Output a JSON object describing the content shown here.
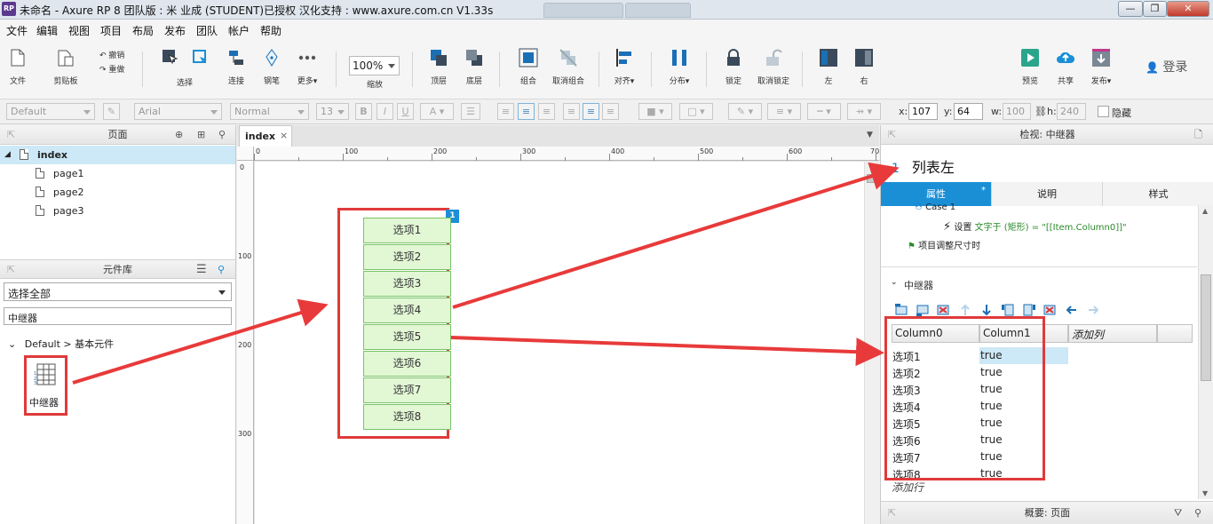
{
  "window": {
    "title": "未命名 - Axure RP 8 团队版 : 米 业成 (STUDENT)已授权 汉化支持 : www.axure.com.cn V1.33s",
    "logo": "RP"
  },
  "menu": [
    "文件",
    "编辑",
    "视图",
    "项目",
    "布局",
    "发布",
    "团队",
    "帐户",
    "帮助"
  ],
  "toolbar": {
    "file": "文件",
    "clipboard": "剪贴板",
    "undo": "撤销",
    "redo": "重做",
    "select": "选择",
    "connect": "连接",
    "pen": "钢笔",
    "more": "更多▾",
    "zoom_value": "100%",
    "zoom_label": "缩放",
    "top": "顶层",
    "bottom": "底层",
    "group": "组合",
    "ungroup": "取消组合",
    "align": "对齐▾",
    "distribute": "分布▾",
    "lock": "锁定",
    "unlock": "取消锁定",
    "left": "左",
    "right": "右",
    "preview": "预览",
    "share": "共享",
    "publish": "发布▾",
    "login": "登录"
  },
  "formatbar": {
    "style": "Default",
    "font": "Arial",
    "weight": "Normal",
    "size": "13",
    "x_label": "x:",
    "x": "107",
    "y_label": "y:",
    "y": "64",
    "w_label": "w:",
    "w": "100",
    "h_label": "h:",
    "h": "240",
    "hide": "隐藏"
  },
  "pages_panel": {
    "title": "页面",
    "pages": [
      "index",
      "page1",
      "page2",
      "page3"
    ]
  },
  "library_panel": {
    "title": "元件库",
    "filter": "选择全部",
    "search": "中继器",
    "group": "Default > 基本元件",
    "widget": "中继器"
  },
  "canvas": {
    "tab": "index",
    "tab_close": "×",
    "ruler_top": [
      "0",
      "100",
      "200",
      "300",
      "400",
      "500",
      "600",
      "70"
    ],
    "ruler_left": [
      "0",
      "100",
      "200",
      "300"
    ],
    "badge": "1",
    "items": [
      "选项1",
      "选项2",
      "选项3",
      "选项4",
      "选项5",
      "选项6",
      "选项7",
      "选项8"
    ]
  },
  "inspector": {
    "title": "检视: 中继器",
    "index": "1",
    "name": "列表左",
    "tabs": [
      "属性",
      "说明",
      "样式"
    ],
    "tab_marker": "*",
    "case": "Case 1",
    "action_prefix": "设置",
    "action_green": "文字于 (矩形)",
    "action_value": "= \"[[Item.Column0]]\"",
    "event": "项目调整尺寸时",
    "section": "中继器",
    "columns": [
      "Column0",
      "Column1",
      "添加列"
    ],
    "rows": [
      [
        "选项1",
        "true"
      ],
      [
        "选项2",
        "true"
      ],
      [
        "选项3",
        "true"
      ],
      [
        "选项4",
        "true"
      ],
      [
        "选项5",
        "true"
      ],
      [
        "选项6",
        "true"
      ],
      [
        "选项7",
        "true"
      ],
      [
        "选项8",
        "true"
      ]
    ],
    "add_row": "添加行",
    "overview": "概要: 页面"
  },
  "colors": {
    "accent": "#1a8fd6",
    "highlight_red": "#e03a3a",
    "item_fill": "#e2f7d4",
    "item_border": "#7ac36a"
  }
}
